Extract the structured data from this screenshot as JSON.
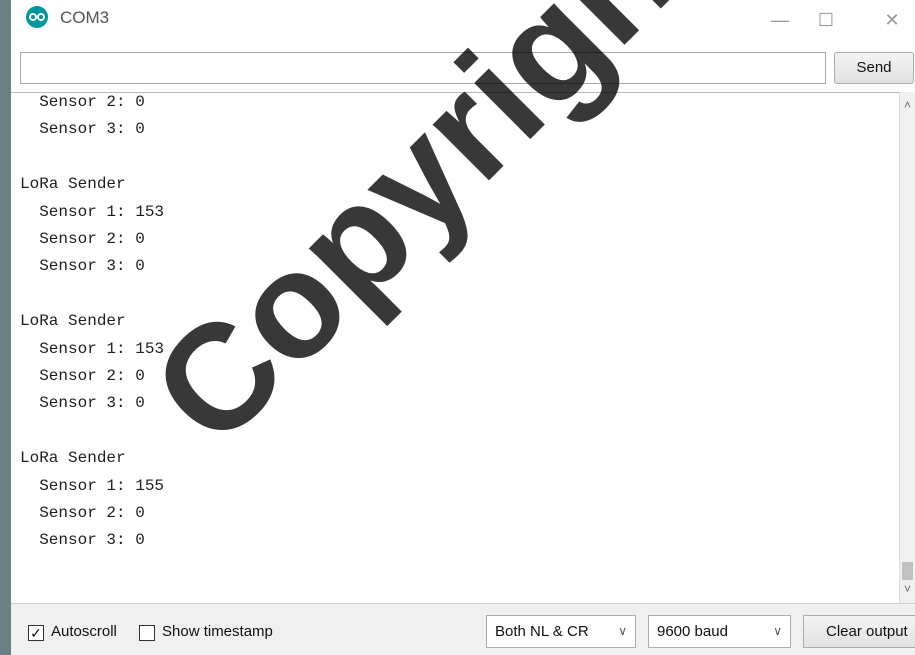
{
  "window": {
    "title": "COM3",
    "minimize": "—",
    "maximize": "☐",
    "close": "✕"
  },
  "send": {
    "input_value": "",
    "button_label": "Send"
  },
  "output": {
    "lines": [
      "  Sensor 2: 0",
      "  Sensor 3: 0",
      "",
      "LoRa Sender",
      "  Sensor 1: 153",
      "  Sensor 2: 0",
      "  Sensor 3: 0",
      "",
      "LoRa Sender",
      "  Sensor 1: 153",
      "  Sensor 2: 0",
      "  Sensor 3: 0",
      "",
      "LoRa Sender",
      "  Sensor 1: 155",
      "  Sensor 2: 0",
      "  Sensor 3: 0"
    ]
  },
  "footer": {
    "autoscroll_label": "Autoscroll",
    "autoscroll_checked": true,
    "timestamp_label": "Show timestamp",
    "timestamp_checked": false,
    "line_ending": "Both NL & CR",
    "baud": "9600 baud",
    "clear_label": "Clear output"
  },
  "watermark": "Copyright@FTS"
}
